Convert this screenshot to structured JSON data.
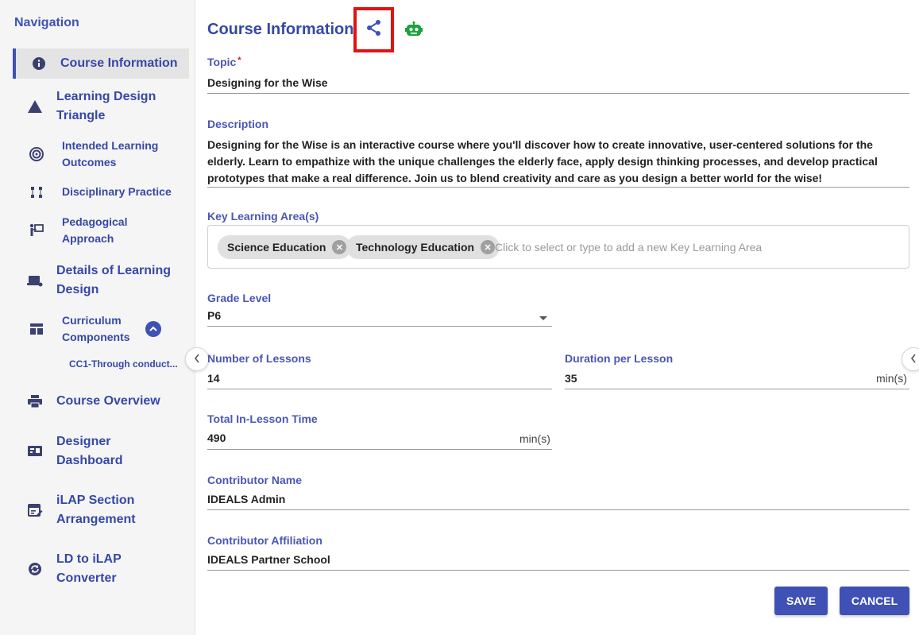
{
  "sidebar": {
    "title": "Navigation",
    "items": [
      {
        "label": "Course Information",
        "icon": "info-icon"
      },
      {
        "label": "Learning Design Triangle",
        "icon": "triangle-icon"
      },
      {
        "label": "Intended Learning Outcomes",
        "icon": "target-icon"
      },
      {
        "label": "Disciplinary Practice",
        "icon": "flow-icon"
      },
      {
        "label": "Pedagogical Approach",
        "icon": "presentation-icon"
      },
      {
        "label": "Details of Learning Design",
        "icon": "laptop-icon"
      },
      {
        "label": "Curriculum Components",
        "icon": "dashboard-icon"
      },
      {
        "label": "CC1-Through conduct...",
        "icon": ""
      },
      {
        "label": "Course Overview",
        "icon": "printer-icon"
      },
      {
        "label": "Designer Dashboard",
        "icon": "board-icon"
      },
      {
        "label": "iLAP Section Arrangement",
        "icon": "calendar-edit-icon"
      },
      {
        "label": "LD to iLAP Converter",
        "icon": "convert-icon"
      }
    ]
  },
  "main": {
    "title": "Course Information",
    "topic": {
      "label": "Topic",
      "required_mark": "*",
      "value": "Designing for the Wise"
    },
    "description": {
      "label": "Description",
      "value": "Designing for the Wise is an interactive course where you'll discover how to create innovative, user-centered solutions for the elderly. Learn to empathize with the unique challenges the elderly face, apply design thinking processes, and develop practical prototypes that make a real difference. Join us to blend creativity and care as you design a better world for the wise!"
    },
    "kla": {
      "label": "Key Learning Area(s)",
      "chips": [
        "Science Education",
        "Technology Education"
      ],
      "placeholder": "Click to select or type to add a new Key Learning Area"
    },
    "grade": {
      "label": "Grade Level",
      "value": "P6"
    },
    "lessons": {
      "label": "Number of Lessons",
      "value": "14"
    },
    "duration": {
      "label": "Duration per Lesson",
      "value": "35",
      "unit": "min(s)"
    },
    "total": {
      "label": "Total In-Lesson Time",
      "value": "490",
      "unit": "min(s)"
    },
    "contributor_name": {
      "label": "Contributor Name",
      "value": "IDEALS Admin"
    },
    "contributor_affiliation": {
      "label": "Contributor Affiliation",
      "value": "IDEALS Partner School"
    },
    "save_label": "SAVE",
    "cancel_label": "CANCEL"
  },
  "colors": {
    "accent": "#3f51b5",
    "highlight_box": "#e01313",
    "robot": "#1aa33c"
  }
}
